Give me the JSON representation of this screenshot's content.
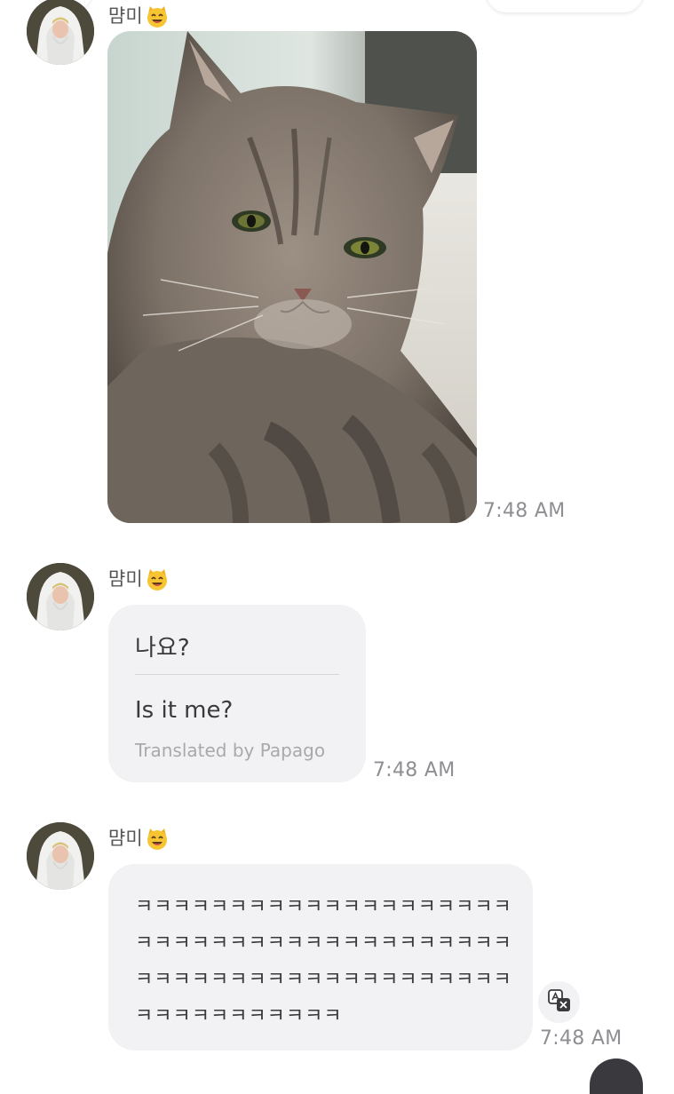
{
  "messages": [
    {
      "sender": "먐미",
      "type": "image",
      "time": "7:48 AM"
    },
    {
      "sender": "먐미",
      "type": "translated-text",
      "original": "나요?",
      "translation": "Is it me?",
      "credit": "Translated by Papago",
      "time": "7:48 AM"
    },
    {
      "sender": "먐미",
      "type": "text",
      "text": "ㅋㅋㅋㅋㅋㅋㅋㅋㅋㅋㅋㅋㅋㅋㅋㅋㅋㅋㅋㅋㅋㅋㅋㅋㅋㅋㅋㅋㅋㅋㅋㅋㅋㅋㅋㅋㅋㅋㅋㅋㅋㅋㅋㅋㅋㅋㅋㅋㅋㅋㅋㅋㅋㅋㅋㅋㅋㅋㅋㅋㅋㅋㅋㅋㅋㅋㅋㅋㅋㅋㅋ",
      "time": "7:48 AM"
    }
  ],
  "icons": {
    "sender_emoji": "cat-face-emoji",
    "translate": "translate-icon"
  },
  "colors": {
    "bubble": "#f2f2f4",
    "timestamp": "#8e8e93",
    "credit": "#a9a9ad"
  }
}
